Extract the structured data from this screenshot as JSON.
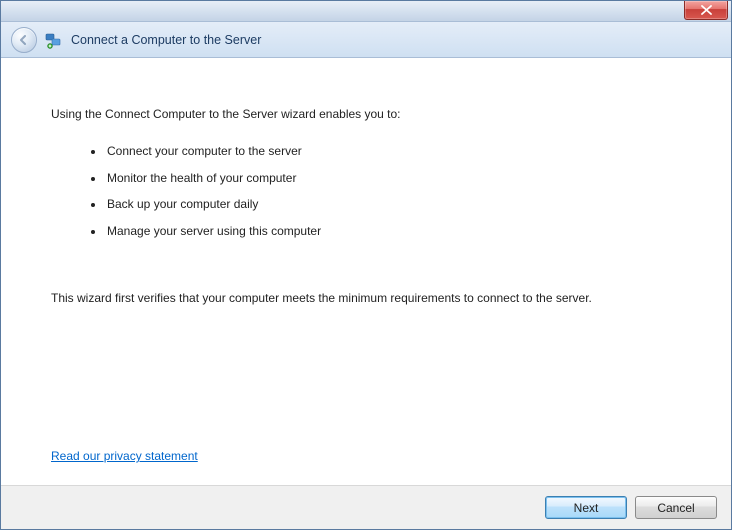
{
  "header": {
    "title": "Connect a Computer to the Server"
  },
  "content": {
    "intro": "Using the Connect Computer to the Server wizard enables you to:",
    "features": [
      "Connect your computer to the server",
      "Monitor the health of your computer",
      "Back up your computer daily",
      "Manage your server using this computer"
    ],
    "verify": "This wizard first verifies that your computer meets the minimum requirements to connect to the server.",
    "privacy_link": "Read our privacy statement"
  },
  "footer": {
    "next": "Next",
    "cancel": "Cancel"
  }
}
